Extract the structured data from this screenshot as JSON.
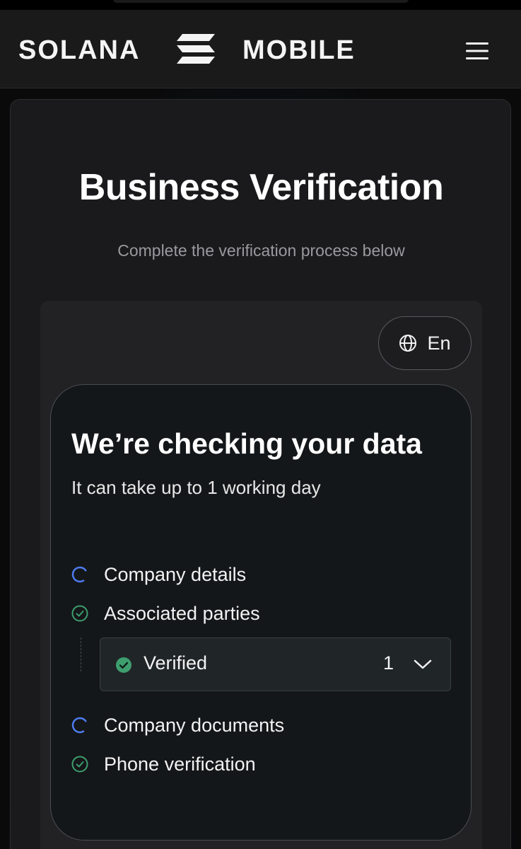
{
  "header": {
    "brand_left": "SOLANA",
    "brand_right": "MOBILE",
    "logo_icon": "solana-logo-icon",
    "menu_icon": "hamburger-menu-icon"
  },
  "page": {
    "title": "Business Verification",
    "subtitle": "Complete the verification process below"
  },
  "language": {
    "icon": "globe-icon",
    "label": "En"
  },
  "status": {
    "title": "We’re checking your data",
    "subtitle": "It can take up to 1 working day",
    "steps": [
      {
        "label": "Company details",
        "state": "loading",
        "icon": "spinner-icon"
      },
      {
        "label": "Associated parties",
        "state": "done",
        "icon": "check-circle-icon"
      },
      {
        "label": "Company documents",
        "state": "loading",
        "icon": "spinner-icon"
      },
      {
        "label": "Phone verification",
        "state": "done",
        "icon": "check-circle-icon"
      }
    ],
    "verified": {
      "label": "Verified",
      "count": "1",
      "icon": "check-filled-icon",
      "chevron": "chevron-down-icon"
    }
  },
  "colors": {
    "accent_blue": "#4d7cf0",
    "success_green": "#3e9e6e",
    "card_bg": "#1a1a1c",
    "status_card_bg": "#141719"
  }
}
